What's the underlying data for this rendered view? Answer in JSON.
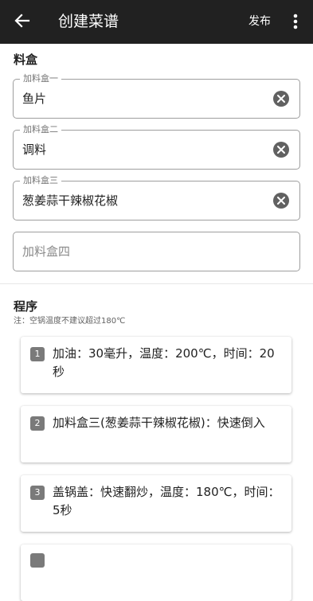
{
  "appbar": {
    "title": "创建菜谱",
    "publish_label": "发布",
    "back_icon": "arrow-left-icon",
    "more_icon": "more-vertical-icon"
  },
  "ingredients": {
    "title": "料盒",
    "fields": [
      {
        "label": "加料盒一",
        "value": "鱼片"
      },
      {
        "label": "加料盒二",
        "value": "调料"
      },
      {
        "label": "加料盒三",
        "value": "葱姜蒜干辣椒花椒"
      },
      {
        "placeholder": "加料盒四"
      }
    ]
  },
  "procedure": {
    "title": "程序",
    "note": "注：空锅温度不建议超过180℃",
    "steps": [
      {
        "num": "1",
        "text": "加油：30毫升，温度：200℃，时间：20秒"
      },
      {
        "num": "2",
        "text": "加料盒三(葱姜蒜干辣椒花椒)：快速倒入"
      },
      {
        "num": "3",
        "text": "盖锅盖：快速翻炒，温度：180℃，时间：5秒"
      }
    ]
  },
  "colors": {
    "appbar_bg": "#212121",
    "field_border": "#9e9e9e",
    "step_badge": "#7a7a7a"
  }
}
